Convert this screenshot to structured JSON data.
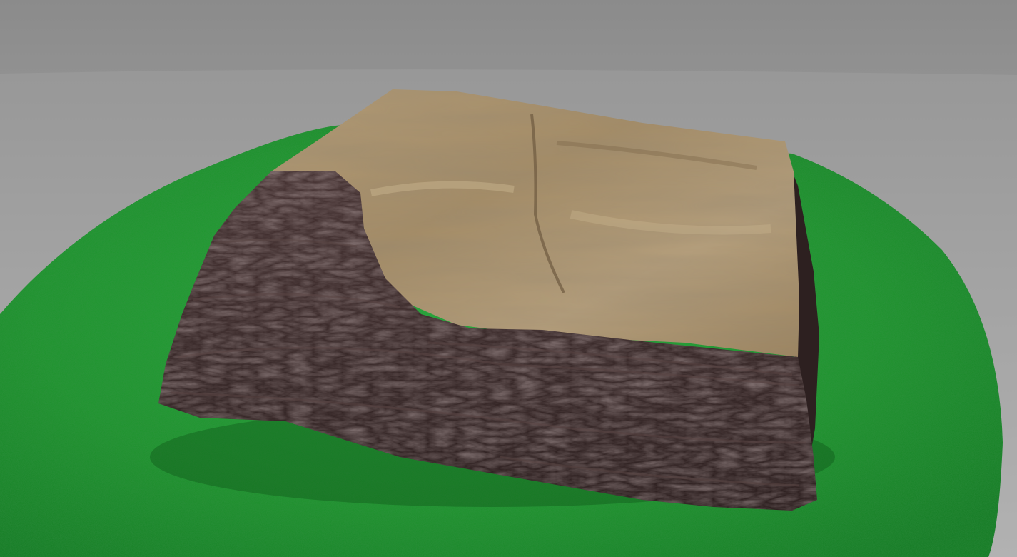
{
  "scene": {
    "subject": "tree-stump-cross-section-3d-scan",
    "colors": {
      "background_top": "#8a8a8a",
      "background_bottom": "#b9b9b9",
      "grass": "#1f9a2f",
      "grass_dark": "#137a22",
      "wood_top": "#a58d66",
      "wood_light": "#c2ab86",
      "bark": "#3b2b2a",
      "bark_dark": "#241818"
    }
  }
}
